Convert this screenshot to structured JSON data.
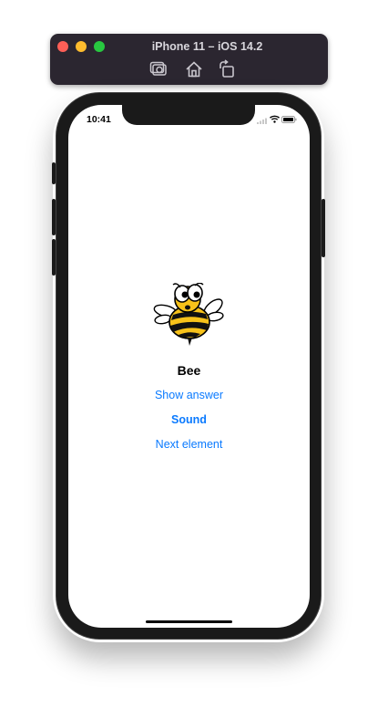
{
  "simulator": {
    "title": "iPhone 11 – iOS 14.2",
    "tools": [
      "screenshot-icon",
      "home-icon",
      "rotate-icon"
    ]
  },
  "status_bar": {
    "time": "10:41"
  },
  "card": {
    "word": "Bee",
    "show_answer": "Show answer",
    "sound": "Sound",
    "next": "Next element"
  },
  "colors": {
    "link": "#0a7aff",
    "toolbar": "#2b2630",
    "bee_yellow": "#f7c21a"
  }
}
